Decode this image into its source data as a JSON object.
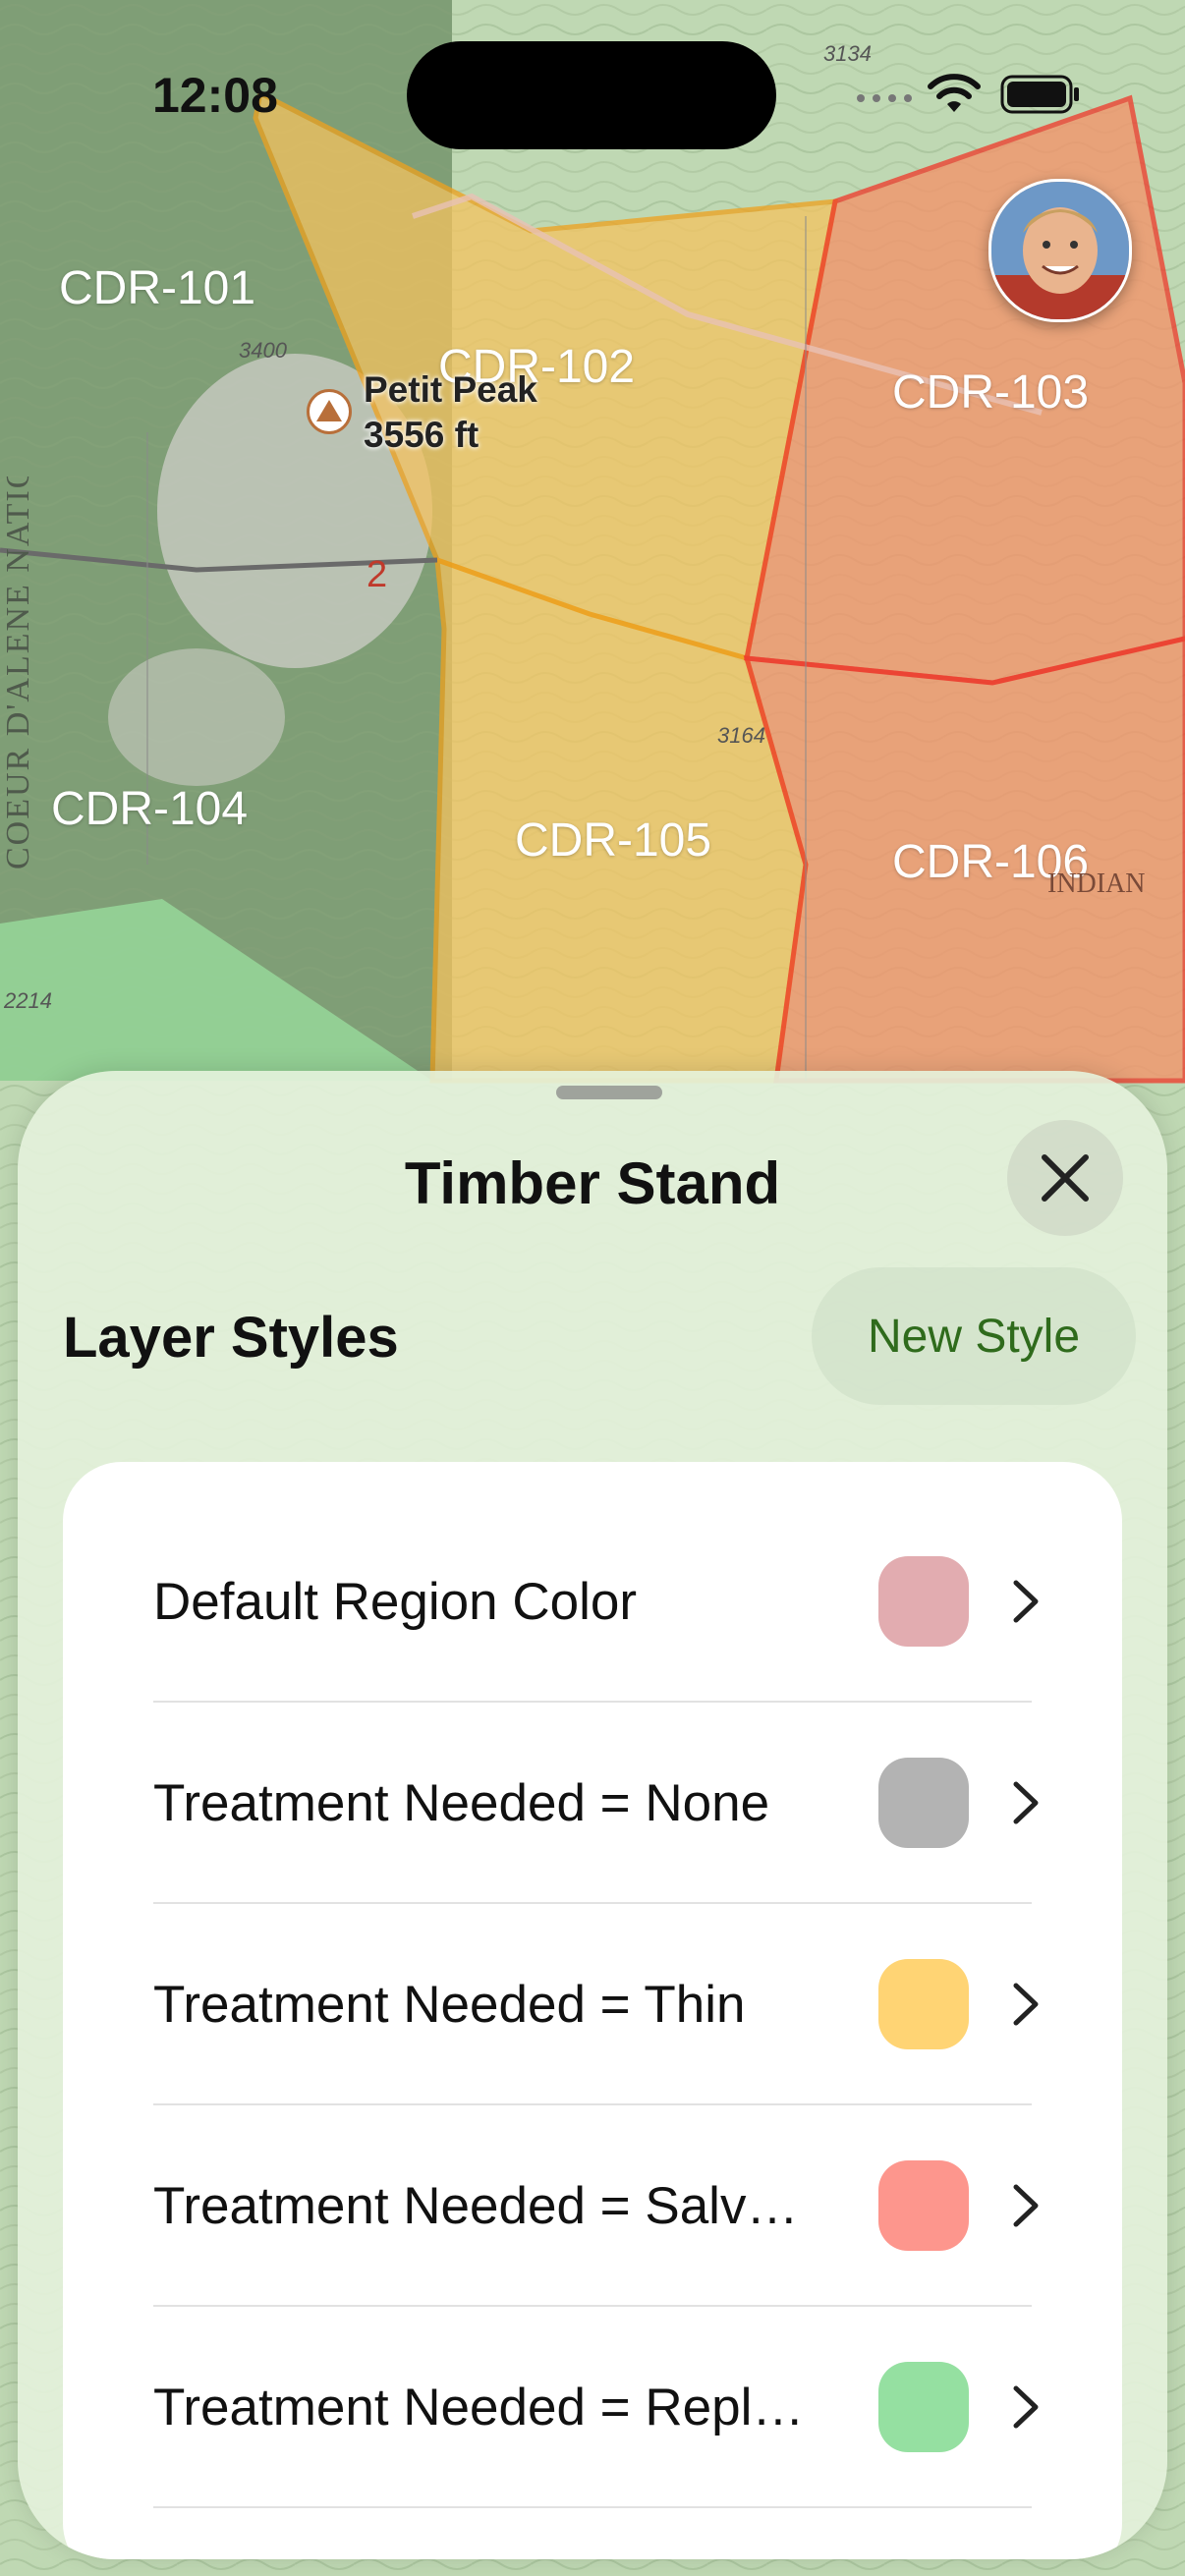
{
  "status_bar": {
    "time": "12:08"
  },
  "map": {
    "regions": [
      {
        "label": "CDR-101"
      },
      {
        "label": "CDR-102"
      },
      {
        "label": "CDR-103"
      },
      {
        "label": "CDR-104"
      },
      {
        "label": "CDR-105"
      },
      {
        "label": "CDR-106"
      }
    ],
    "peak": {
      "name": "Petit Peak",
      "elevation": "3556 ft"
    },
    "forest_label": "COEUR D'ALENE NATIONAL FOREST",
    "route_number": "2",
    "contour_labels": [
      "3134",
      "3400",
      "3164",
      "2214"
    ],
    "area_label": "INDIAN"
  },
  "sheet": {
    "title": "Timber Stand",
    "section_title": "Layer Styles",
    "new_style_label": "New Style",
    "styles": [
      {
        "label": "Default Region Color",
        "color": "#e2acb0"
      },
      {
        "label": "Treatment Needed = None",
        "color": "#b3b3b3"
      },
      {
        "label": "Treatment Needed = Thin",
        "color": "#ffd474"
      },
      {
        "label": "Treatment Needed = Salv…",
        "color": "#fd968d"
      },
      {
        "label": "Treatment Needed = Repl…",
        "color": "#95e0a1"
      }
    ]
  },
  "icons": {
    "close": "close-icon",
    "chevron": "chevron-right-icon",
    "wifi": "wifi-icon",
    "battery": "battery-icon",
    "peak": "mountain-peak-icon"
  }
}
